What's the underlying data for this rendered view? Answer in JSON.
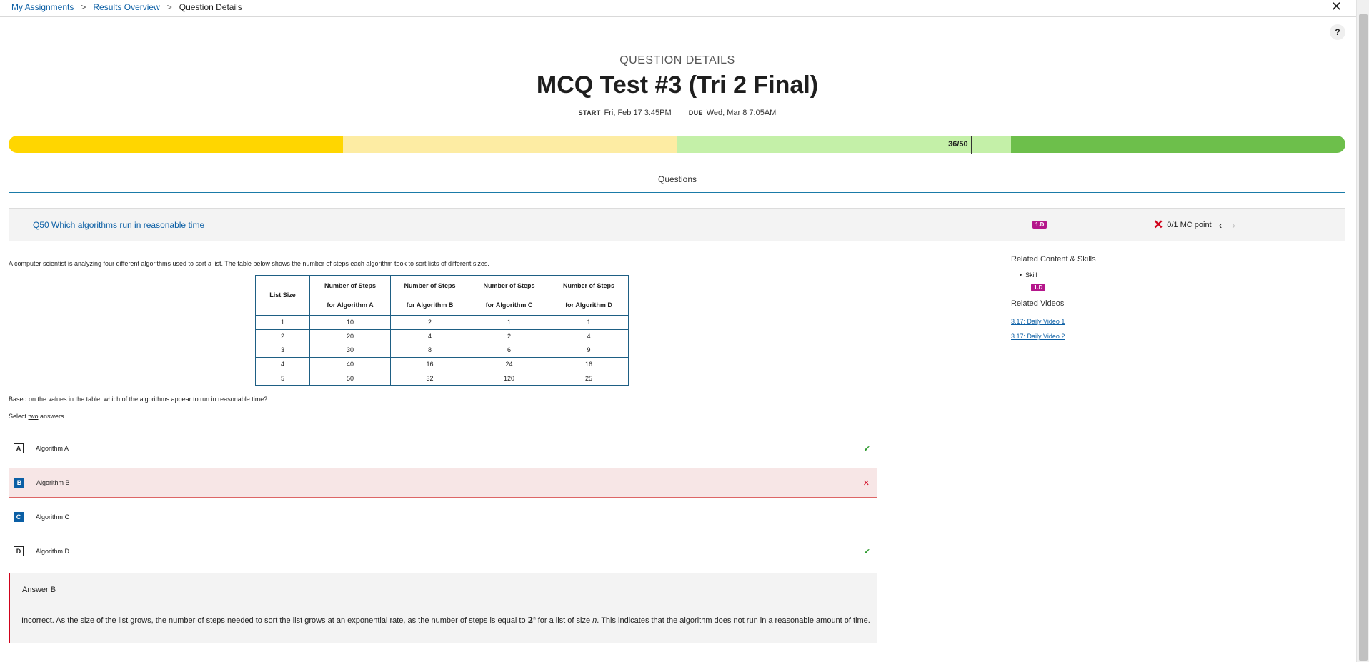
{
  "breadcrumb": {
    "items": [
      "My Assignments",
      "Results Overview"
    ],
    "separator": ">",
    "current": "Question Details"
  },
  "help_label": "?",
  "close_label": "✕",
  "header": {
    "label": "QUESTION DETAILS",
    "title": "MCQ Test #3 (Tri 2 Final)",
    "start_label": "START",
    "start_value": "Fri, Feb 17 3:45PM",
    "due_label": "DUE",
    "due_value": "Wed, Mar 8 7:05AM"
  },
  "progress": {
    "score": "36/50",
    "score_fraction": 0.72,
    "colors": [
      "#ffd600",
      "#fdeca3",
      "#c4f0a8",
      "#6dbf4b"
    ]
  },
  "tabs": {
    "questions": "Questions"
  },
  "question_bar": {
    "title": "Q50 Which algorithms run in reasonable time",
    "badge": "1.D",
    "score_icon": "✕",
    "score": "0/1 MC point",
    "prev": "‹",
    "next": "›"
  },
  "prompt": "A computer scientist is analyzing four different algorithms used to sort a list. The table below shows the number of steps each algorithm took to sort lists of different sizes.",
  "table": {
    "headers": [
      [
        "List Size"
      ],
      [
        "Number of Steps",
        "for Algorithm A"
      ],
      [
        "Number of Steps",
        "for Algorithm B"
      ],
      [
        "Number of Steps",
        "for Algorithm C"
      ],
      [
        "Number of Steps",
        "for Algorithm D"
      ]
    ],
    "rows": [
      [
        "1",
        "10",
        "2",
        "1",
        "1"
      ],
      [
        "2",
        "20",
        "4",
        "2",
        "4"
      ],
      [
        "3",
        "30",
        "8",
        "6",
        "9"
      ],
      [
        "4",
        "40",
        "16",
        "24",
        "16"
      ],
      [
        "5",
        "50",
        "32",
        "120",
        "25"
      ]
    ]
  },
  "question": "Based on the values in the table, which of the algorithms appear to run in reasonable time?",
  "select_pre": "Select ",
  "select_word": "two",
  "select_post": " answers.",
  "choices": [
    {
      "letter": "A",
      "text": "Algorithm A",
      "mark": "✔",
      "state": "correct"
    },
    {
      "letter": "B",
      "text": "Algorithm B",
      "mark": "✕",
      "state": "wrong"
    },
    {
      "letter": "C",
      "text": "Algorithm C",
      "mark": "",
      "state": "selected"
    },
    {
      "letter": "D",
      "text": "Algorithm D",
      "mark": "✔",
      "state": "correct"
    }
  ],
  "explanation": {
    "answer": "Answer B",
    "text_pre": "Incorrect. As the size of the list grows, the number of steps needed to sort the list grows at an exponential rate, as the number of steps is equal to ",
    "base": "2",
    "exp": "n",
    "text_mid": " for a list of size ",
    "var": "n",
    "text_post": ". This indicates that the algorithm does not run in a reasonable amount of time."
  },
  "sidebar": {
    "related_title": "Related Content & Skills",
    "skill_label": "Skill",
    "skill_badge": "1.D",
    "videos_title": "Related Videos",
    "videos": [
      "3.17: Daily Video 1",
      "3.17: Daily Video 2"
    ]
  }
}
